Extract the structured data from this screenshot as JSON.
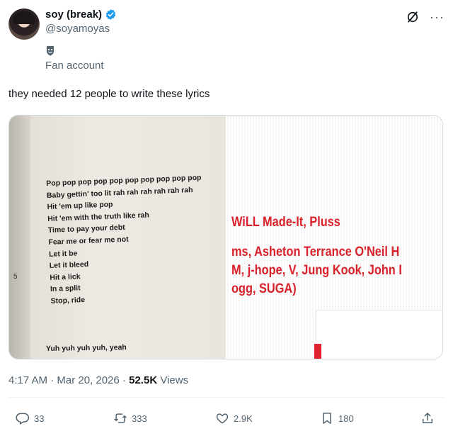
{
  "author": {
    "display_name": "soy (break)",
    "handle": "@soyamoyas",
    "affiliation": "Fan account",
    "verified": true
  },
  "tweet": {
    "text": "they needed 12 people to write these lyrics"
  },
  "media": {
    "left_image": {
      "page_number": "5",
      "lyrics": [
        "Pop pop pop pop pop pop pop pop pop pop",
        "Baby gettin' too lit rah rah rah rah rah rah",
        "Hit 'em up like pop",
        "Hit 'em with the truth like rah",
        "Time to pay your debt",
        "Fear me or fear me not",
        "Let it be",
        "Let it bleed",
        "Hit a lick",
        "In a split",
        "Stop, ride"
      ],
      "last_line": "Yuh yuh yuh yuh, yeah"
    },
    "right_image": {
      "credits": [
        "WiLL Made-It, Pluss",
        "ms, Asheton Terrance O'Neil H",
        "M, j-hope, V, Jung Kook, John I",
        "ogg, SUGA)"
      ]
    }
  },
  "meta": {
    "time": "4:17 AM",
    "separator": "·",
    "date": "Mar 20, 2026",
    "views_count": "52.5K",
    "views_label": "Views"
  },
  "actions": {
    "replies": "33",
    "reposts": "333",
    "likes": "2.9K",
    "bookmarks": "180"
  },
  "colors": {
    "accent": "#1d9bf0",
    "secondary_text": "#536471",
    "credit_red": "#d9212b"
  },
  "icons": [
    "verified-badge-icon",
    "fan-account-badge-icon",
    "grok-icon",
    "more-icon",
    "reply-icon",
    "repost-icon",
    "like-icon",
    "bookmark-icon",
    "share-icon"
  ]
}
